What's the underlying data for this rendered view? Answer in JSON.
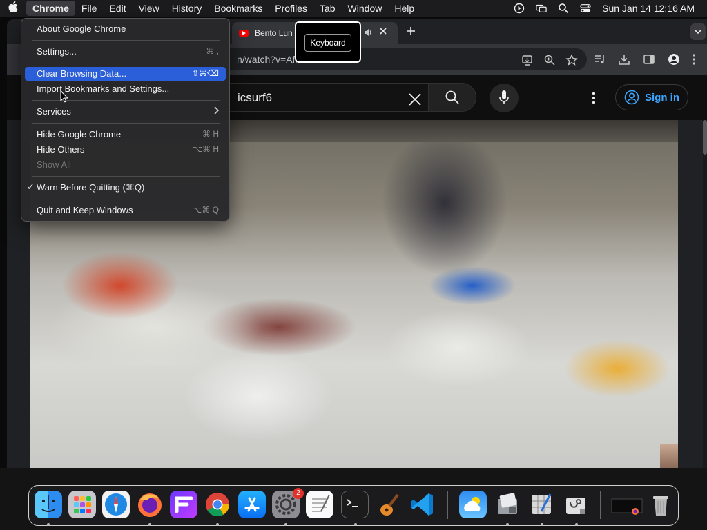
{
  "menubar": {
    "app": "Chrome",
    "items": [
      "File",
      "Edit",
      "View",
      "History",
      "Bookmarks",
      "Profiles",
      "Tab",
      "Window",
      "Help"
    ],
    "clock": "Sun Jan 14  12:16 AM"
  },
  "browser": {
    "tab_title": "Bento Lun",
    "url_fragment": "n/watch?v=Afft"
  },
  "tooltip": {
    "label": "Keyboard"
  },
  "youtube": {
    "search_query": "icsurf6",
    "sign_in": "Sign in"
  },
  "app_menu": {
    "about": "About Google Chrome",
    "settings": "Settings...",
    "settings_shortcut": "⌘ ,",
    "clear": "Clear Browsing Data...",
    "clear_shortcut": "⇧⌘⌫",
    "import": "Import Bookmarks and Settings...",
    "services": "Services",
    "hide": "Hide Google Chrome",
    "hide_shortcut": "⌘ H",
    "hide_others": "Hide Others",
    "hide_others_shortcut": "⌥⌘ H",
    "show_all": "Show All",
    "warn": "Warn Before Quitting (⌘Q)",
    "quit": "Quit and Keep Windows",
    "quit_shortcut": "⌥⌘ Q"
  },
  "dock": {
    "settings_badge": "2",
    "icons": [
      "finder-icon",
      "launchpad-icon",
      "safari-icon",
      "firefox-icon",
      "fantastical-icon",
      "chrome-icon",
      "app-store-icon",
      "system-settings-icon",
      "textedit-icon",
      "terminal-icon",
      "garageband-icon",
      "vscode-icon",
      "weather-icon",
      "preview-icon",
      "pages-icon",
      "disk-utility-icon",
      "minimized-window-icon",
      "trash-icon"
    ]
  },
  "colors": {
    "highlight": "#2b5fd9",
    "youtube_blue": "#3ea6ff",
    "youtube_red": "#ff0000"
  }
}
